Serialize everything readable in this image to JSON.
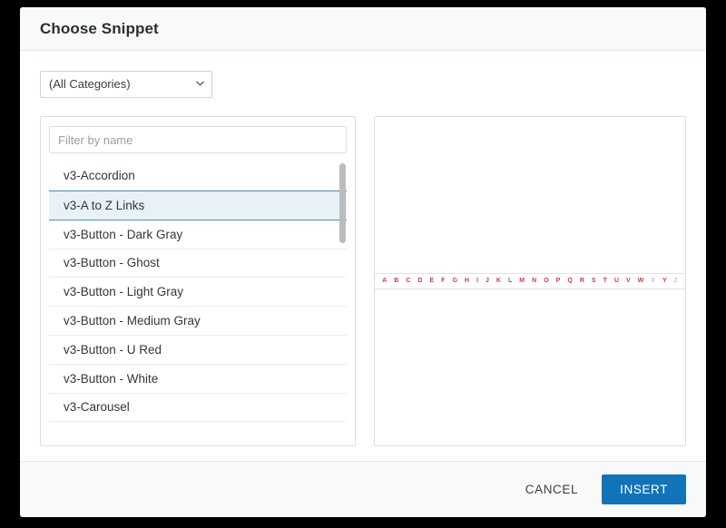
{
  "modal": {
    "title": "Choose Snippet"
  },
  "category": {
    "selected": "(All Categories)",
    "options": [
      "(All Categories)"
    ],
    "chevron_icon": "chevron-down-icon"
  },
  "filter": {
    "value": "",
    "placeholder": "Filter by name"
  },
  "snippet_list": {
    "items": [
      {
        "label": "v3-Accordion",
        "selected": false
      },
      {
        "label": "v3-A to Z Links",
        "selected": true
      },
      {
        "label": "v3-Button - Dark Gray",
        "selected": false
      },
      {
        "label": "v3-Button - Ghost",
        "selected": false
      },
      {
        "label": "v3-Button - Light Gray",
        "selected": false
      },
      {
        "label": "v3-Button - Medium Gray",
        "selected": false
      },
      {
        "label": "v3-Button - U Red",
        "selected": false
      },
      {
        "label": "v3-Button - White",
        "selected": false
      },
      {
        "label": "v3-Carousel",
        "selected": false
      }
    ]
  },
  "preview": {
    "az_links": [
      {
        "letter": "A",
        "enabled": true
      },
      {
        "letter": "B",
        "enabled": true
      },
      {
        "letter": "C",
        "enabled": true
      },
      {
        "letter": "D",
        "enabled": true
      },
      {
        "letter": "E",
        "enabled": true
      },
      {
        "letter": "F",
        "enabled": true
      },
      {
        "letter": "G",
        "enabled": true
      },
      {
        "letter": "H",
        "enabled": true
      },
      {
        "letter": "I",
        "enabled": true
      },
      {
        "letter": "J",
        "enabled": true
      },
      {
        "letter": "K",
        "enabled": true
      },
      {
        "letter": "L",
        "enabled": true
      },
      {
        "letter": "M",
        "enabled": true
      },
      {
        "letter": "N",
        "enabled": true
      },
      {
        "letter": "O",
        "enabled": true
      },
      {
        "letter": "P",
        "enabled": true
      },
      {
        "letter": "Q",
        "enabled": true
      },
      {
        "letter": "R",
        "enabled": true
      },
      {
        "letter": "S",
        "enabled": true
      },
      {
        "letter": "T",
        "enabled": true
      },
      {
        "letter": "U",
        "enabled": true
      },
      {
        "letter": "V",
        "enabled": true
      },
      {
        "letter": "W",
        "enabled": true
      },
      {
        "letter": "X",
        "enabled": false
      },
      {
        "letter": "Y",
        "enabled": true
      },
      {
        "letter": "Z",
        "enabled": false
      }
    ]
  },
  "footer": {
    "cancel_label": "CANCEL",
    "insert_label": "INSERT"
  },
  "colors": {
    "accent_blue": "#1274b8",
    "selected_row_bg": "#e8f1f8",
    "selected_row_border": "#4a94c4",
    "link_red": "#cf3a45",
    "disabled_gray": "#c8c8c8"
  }
}
